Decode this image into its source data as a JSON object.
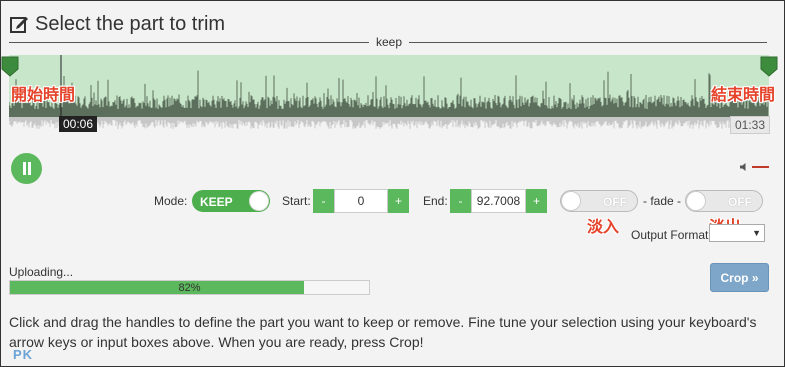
{
  "header": {
    "title": "Select the part to trim",
    "icon": "edit-icon"
  },
  "keep_label": "keep",
  "annotations": {
    "start_time": "開始時間",
    "end_time": "結束時間",
    "fade_in": "淡入",
    "fade_out": "淡出"
  },
  "waveform": {
    "current_time": "00:06",
    "total_time": "01:33",
    "selected_fill": "#c8e6c9",
    "wave_color": "#4a5a4a"
  },
  "player": {
    "state_icon": "pause-icon"
  },
  "controls": {
    "mode_label": "Mode:",
    "mode_value": "KEEP",
    "start_label": "Start:",
    "start_value": "0",
    "end_label": "End:",
    "end_value": "92.7008",
    "minus": "-",
    "plus": "+",
    "fade_label": "- fade -",
    "fade_in_state": "OFF",
    "fade_out_state": "OFF",
    "output_format_label": "Output Format",
    "output_format_value": ""
  },
  "upload": {
    "label": "Uploading...",
    "percent_text": "82%",
    "percent": 82
  },
  "crop_button": "Crop »",
  "instructions": "Click and drag the handles to define the part you want to keep or remove. Fine tune your selection using your keyboard's arrow keys or input boxes above. When you are ready, press Crop!",
  "watermark": "PK",
  "colors": {
    "accent": "#5cb85c",
    "crop": "#7ea6c9",
    "annotation": "#e5432a"
  }
}
